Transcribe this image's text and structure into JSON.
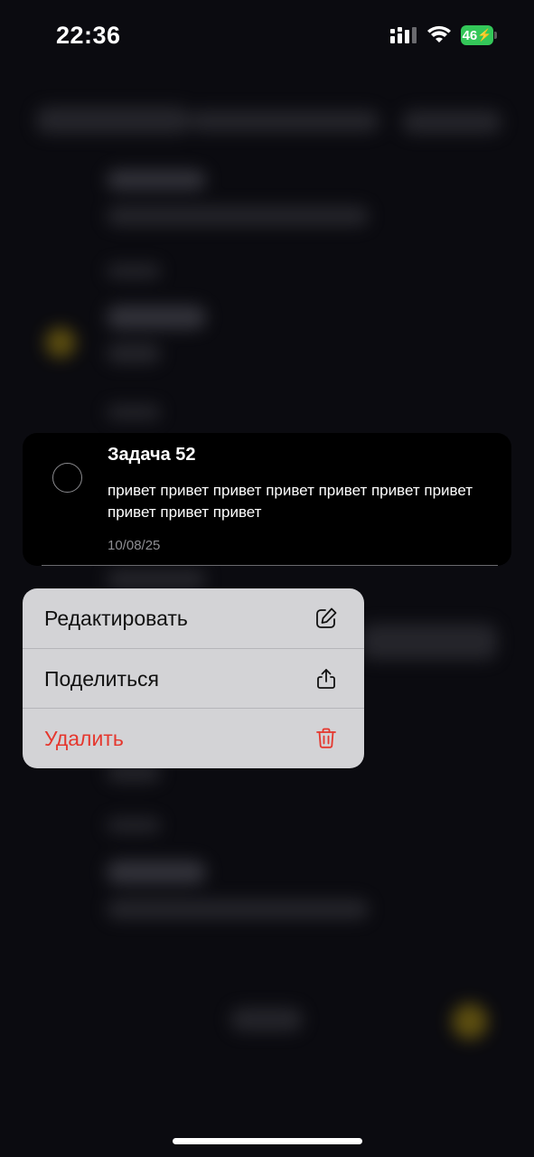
{
  "status_bar": {
    "time": "22:36",
    "battery_level": "46",
    "icons": [
      "cellular-signal-icon",
      "wifi-icon",
      "battery-charging-icon"
    ]
  },
  "task": {
    "title": "Задача 52",
    "text": "привет привет привет привет привет привет привет привет привет привет",
    "date": "10/08/25",
    "completed": false
  },
  "context_menu": {
    "items": [
      {
        "label": "Редактировать",
        "icon": "edit-icon"
      },
      {
        "label": "Поделиться",
        "icon": "share-icon"
      },
      {
        "label": "Удалить",
        "icon": "trash-icon",
        "destructive": true
      }
    ]
  },
  "colors": {
    "background": "#0b0b10",
    "destructive": "#e5372e",
    "battery": "#34c759",
    "menu_background": "#d3d3d6"
  }
}
